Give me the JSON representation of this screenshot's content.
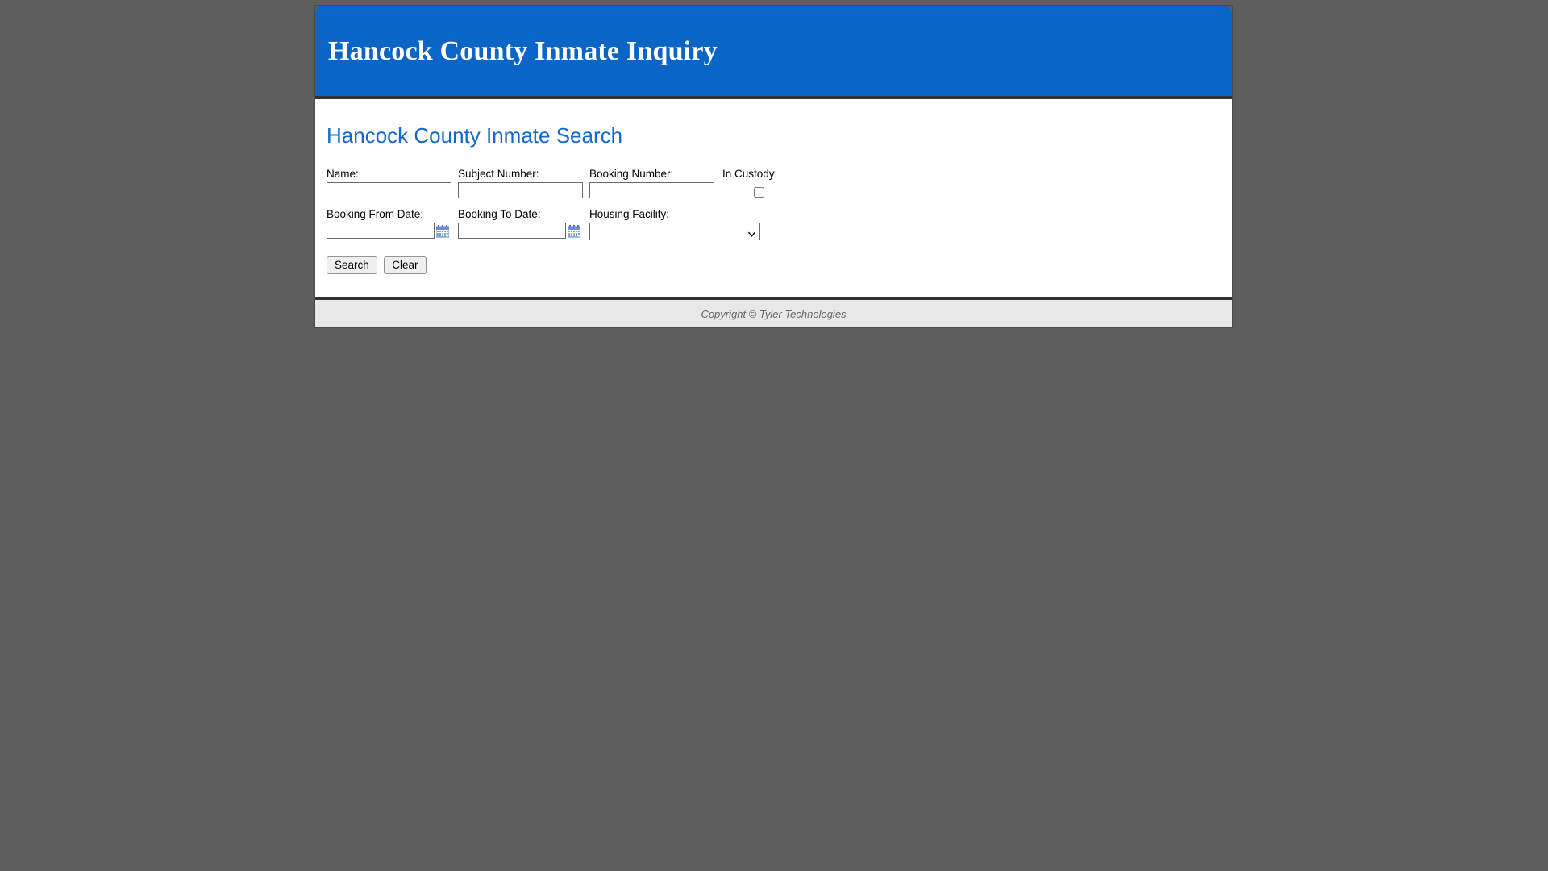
{
  "header": {
    "title": "Hancock County Inmate Inquiry",
    "background_color": "#0a65c6"
  },
  "main": {
    "heading": "Hancock County Inmate Search",
    "heading_color": "#1268cc",
    "form": {
      "fields": [
        {
          "label": "Name:",
          "value": "",
          "type": "text"
        },
        {
          "label": "Subject Number:",
          "value": "",
          "type": "text"
        },
        {
          "label": "Booking Number:",
          "value": "",
          "type": "text"
        },
        {
          "label": "In Custody:",
          "value": "",
          "type": "checkbox",
          "checked": false
        },
        {
          "label": "Booking From Date:",
          "value": "",
          "type": "date"
        },
        {
          "label": "Booking To Date:",
          "value": "",
          "type": "date"
        },
        {
          "label": "Housing Facility:",
          "value": "",
          "type": "select"
        }
      ],
      "housing_facility_selected": "",
      "calendar_icon": "calendar-icon",
      "dropdown_icon": "chevron-down-icon"
    },
    "buttons": {
      "search_label": "Search",
      "clear_label": "Clear"
    }
  },
  "footer": {
    "copyright": "Copyright © Tyler Technologies"
  }
}
